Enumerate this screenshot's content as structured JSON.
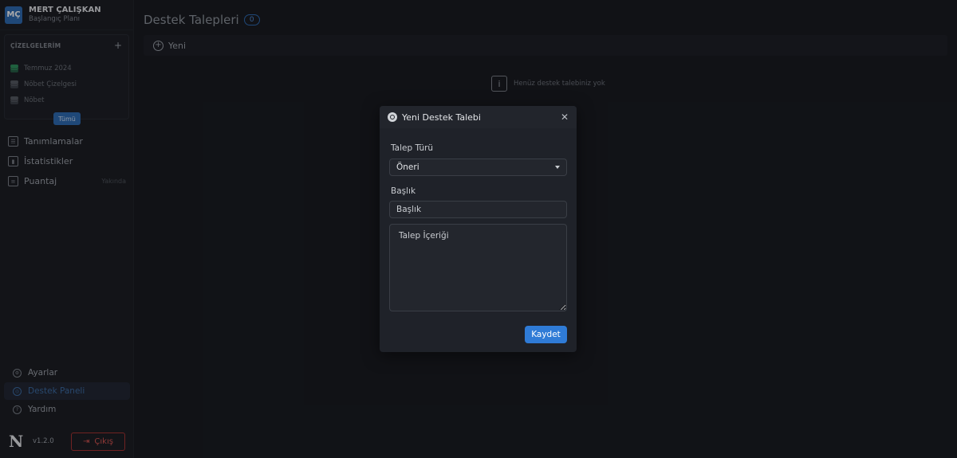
{
  "user": {
    "initials": "MÇ",
    "name": "MERT ÇALIŞKAN",
    "plan": "Başlangıç Planı"
  },
  "schedules": {
    "title": "ÇİZELGELERİM",
    "add_icon": "plus-icon",
    "items": [
      {
        "label": "Temmuz 2024",
        "icon": "layers-icon",
        "color": "#2e9c61"
      },
      {
        "label": "Nöbet Çizelgesi",
        "icon": "layers-icon",
        "color": "#5a5f67"
      },
      {
        "label": "Nöbet",
        "icon": "layers-icon",
        "color": "#5a5f67"
      }
    ],
    "all_label": "Tümü"
  },
  "nav": {
    "items": [
      {
        "label": "Tanımlamalar",
        "icon": "list-check-icon"
      },
      {
        "label": "İstatistikler",
        "icon": "bar-chart-icon"
      },
      {
        "label": "Puantaj",
        "icon": "document-icon",
        "badge": "Yakında"
      }
    ]
  },
  "bottom_nav": {
    "items": [
      {
        "label": "Ayarlar",
        "icon": "gear-icon"
      },
      {
        "label": "Destek Paneli",
        "icon": "support-icon",
        "active": true
      },
      {
        "label": "Yardım",
        "icon": "help-icon"
      }
    ]
  },
  "footer": {
    "logo": "N",
    "version": "v1.2.0",
    "logout_label": "Çıkış"
  },
  "main": {
    "title": "Destek Talepleri",
    "count": "0",
    "new_label": "Yeni",
    "empty_text": "Henüz destek talebiniz yok"
  },
  "modal": {
    "title": "Yeni Destek Talebi",
    "type_label": "Talep Türü",
    "type_value": "Öneri",
    "subject_label": "Başlık",
    "subject_placeholder": "Başlık",
    "content_placeholder": "Talep İçeriği",
    "save_label": "Kaydet"
  },
  "colors": {
    "accent": "#2f7bd6",
    "danger": "#d9534f",
    "success": "#2e9c61"
  }
}
